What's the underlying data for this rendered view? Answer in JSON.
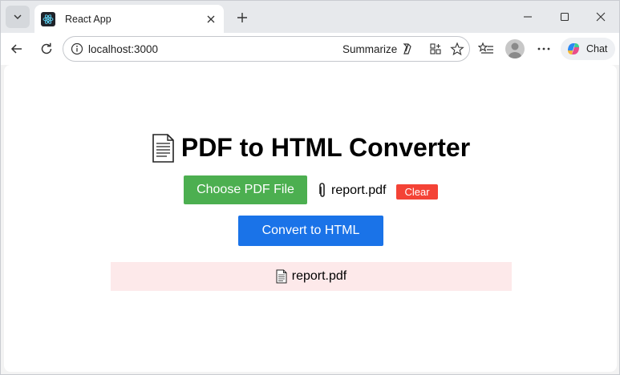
{
  "browser": {
    "tab_title": "React App",
    "url": "localhost:3000",
    "summarize_label": "Summarize",
    "chat_label": "Chat"
  },
  "app": {
    "title": "PDF to HTML Converter",
    "choose_label": "Choose PDF File",
    "selected_file": "report.pdf",
    "clear_label": "Clear",
    "convert_label": "Convert to HTML",
    "status_file": "report.pdf"
  },
  "colors": {
    "choose_button": "#4caf50",
    "clear_button": "#f44336",
    "convert_button": "#1a73e8",
    "status_background": "#fde9ea"
  },
  "icons": [
    "react-icon",
    "document-icon",
    "paperclip-icon",
    "copilot-icon"
  ]
}
